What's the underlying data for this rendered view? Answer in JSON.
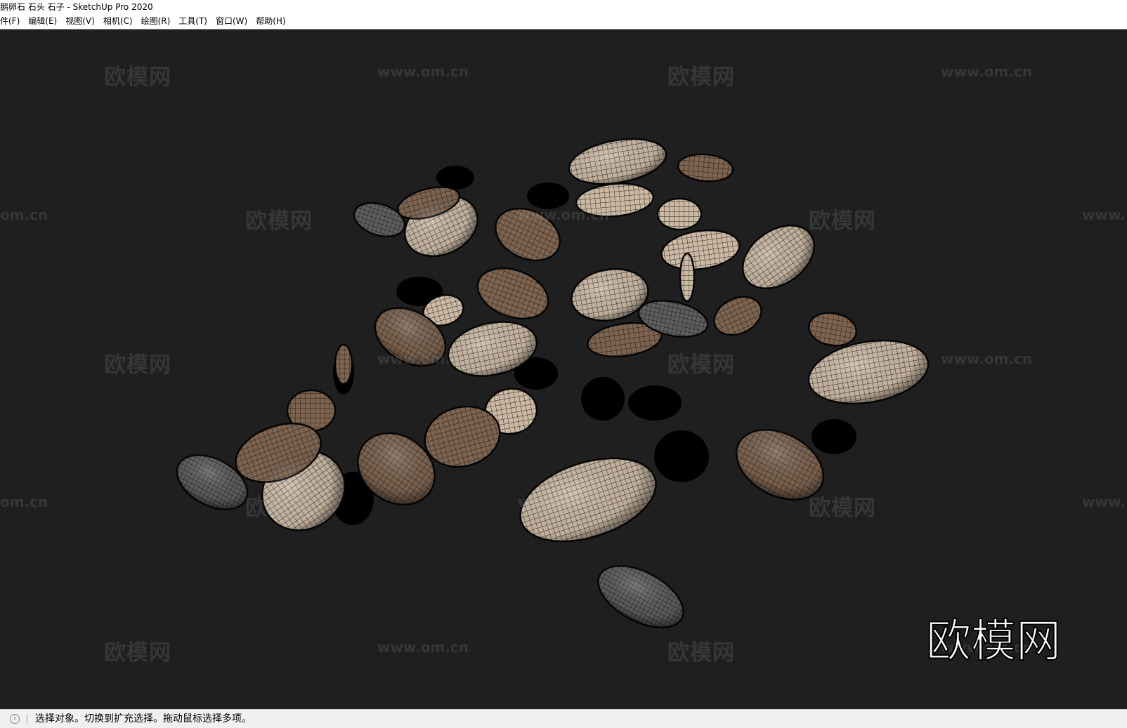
{
  "window": {
    "title": "鹅卵石 石头 石子 - SketchUp Pro 2020"
  },
  "menu": [
    "件(F)",
    "编辑(E)",
    "视图(V)",
    "相机(C)",
    "绘图(R)",
    "工具(T)",
    "窗口(W)",
    "帮助(H)"
  ],
  "watermarks": {
    "brand": "欧模网",
    "url": "www.om.cn",
    "url_partial_left": "om.cn",
    "url_partial_right": "www."
  },
  "status": {
    "icon": "info-icon",
    "text": "选择对象。切换到扩充选择。拖动鼠标选择多项。"
  },
  "colors": {
    "viewport_bg": "#1f1f1f",
    "stone_light": "#cdbba6",
    "stone_brown": "#7a5f4a",
    "stone_grey": "#5a5a5c",
    "shadow": "#000000"
  }
}
